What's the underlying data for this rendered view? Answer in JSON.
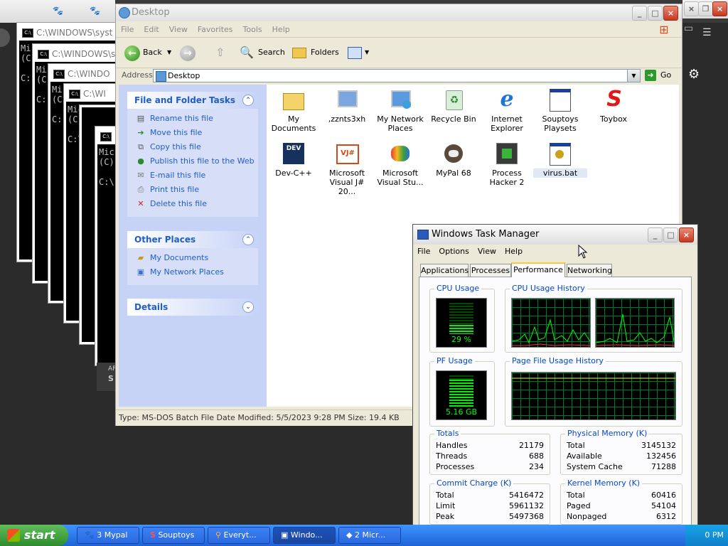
{
  "cmd_windows": [
    {
      "title": "C:\\WINDOWS\\syst",
      "lines": [
        "Mi",
        "(C",
        "",
        "C:"
      ]
    },
    {
      "title": "C:\\WINDOWS\\s",
      "lines": [
        "Mi",
        "(C",
        "",
        "C:"
      ]
    },
    {
      "title": "C:\\WINDO",
      "lines": [
        "Mi",
        "(C",
        "",
        "C:"
      ]
    },
    {
      "title": "C:\\WI",
      "lines": [
        "Microsof",
        "(C) Copy",
        "",
        "C:\\Do"
      ]
    },
    {
      "title": "",
      "lines": [
        "Mic",
        "(C)",
        "",
        "C:\\"
      ]
    }
  ],
  "explorer": {
    "title": "Desktop",
    "menu": [
      "File",
      "Edit",
      "View",
      "Favorites",
      "Tools",
      "Help"
    ],
    "toolbar": {
      "back": "Back",
      "search": "Search",
      "folders": "Folders"
    },
    "address_label": "Address",
    "address_value": "Desktop",
    "go": "Go",
    "file_tasks": {
      "title": "File and Folder Tasks",
      "items": [
        "Rename this file",
        "Move this file",
        "Copy this file",
        "Publish this file to the Web",
        "E-mail this file",
        "Print this file",
        "Delete this file"
      ]
    },
    "other_places": {
      "title": "Other Places",
      "items": [
        "My Documents",
        "My Network Places"
      ]
    },
    "details": {
      "title": "Details"
    },
    "icons": [
      {
        "label": "My Documents"
      },
      {
        "label": ",zznts3xh"
      },
      {
        "label": "My Network Places"
      },
      {
        "label": "Recycle Bin"
      },
      {
        "label": "Internet Explorer"
      },
      {
        "label": "Souptoys Playsets"
      },
      {
        "label": "Toybox"
      },
      {
        "label": "Dev-C++"
      },
      {
        "label": "Microsoft Visual J# 20..."
      },
      {
        "label": "Microsoft Visual Stu..."
      },
      {
        "label": "MyPal 68"
      },
      {
        "label": "Process Hacker 2"
      },
      {
        "label": "virus.bat"
      }
    ],
    "status": "Type: MS-DOS Batch File Date Modified: 5/5/2023 9:28 PM Size: 19.4 KB"
  },
  "task_manager": {
    "title": "Windows Task Manager",
    "menu": [
      "File",
      "Options",
      "View",
      "Help"
    ],
    "tabs": [
      "Applications",
      "Processes",
      "Performance",
      "Networking"
    ],
    "active_tab": "Performance",
    "cpu_usage": {
      "label": "CPU Usage",
      "value": "29 %",
      "level": 0.29
    },
    "cpu_history": {
      "label": "CPU Usage History"
    },
    "pf_usage": {
      "label": "PF Usage",
      "value": "5.16 GB",
      "level": 0.87
    },
    "pf_history": {
      "label": "Page File Usage History"
    },
    "totals": {
      "label": "Totals",
      "rows": [
        [
          "Handles",
          "21179"
        ],
        [
          "Threads",
          "688"
        ],
        [
          "Processes",
          "234"
        ]
      ]
    },
    "physical": {
      "label": "Physical Memory (K)",
      "rows": [
        [
          "Total",
          "3145132"
        ],
        [
          "Available",
          "132456"
        ],
        [
          "System Cache",
          "71288"
        ]
      ]
    },
    "commit": {
      "label": "Commit Charge (K)",
      "rows": [
        [
          "Total",
          "5416472"
        ],
        [
          "Limit",
          "5961132"
        ],
        [
          "Peak",
          "5497368"
        ]
      ]
    },
    "kernel": {
      "label": "Kernel Memory (K)",
      "rows": [
        [
          "Total",
          "60416"
        ],
        [
          "Paged",
          "54104"
        ],
        [
          "Nonpaged",
          "6312"
        ]
      ]
    }
  },
  "taskbar": {
    "start": "start",
    "buttons": [
      {
        "label": "3 Mypal",
        "count": "3"
      },
      {
        "label": "Souptoys"
      },
      {
        "label": "Everyt..."
      },
      {
        "label": "Windo..."
      },
      {
        "label": "2 Micr...",
        "count": "2"
      }
    ],
    "clock": "0 PM"
  },
  "background_label": "AF",
  "background_label2": "S"
}
